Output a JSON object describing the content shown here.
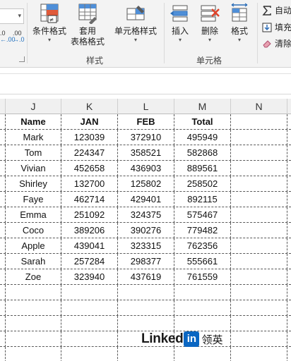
{
  "ribbon": {
    "decimal_buttons": [
      {
        "top": ".0",
        "bottom": "←.00"
      },
      {
        "top": ".00",
        "bottom": "→.0"
      }
    ],
    "style_group": {
      "label": "样式",
      "buttons": [
        {
          "label": "条件格式"
        },
        {
          "label": "套用",
          "label2": "表格格式"
        },
        {
          "label": "单元格样式"
        }
      ]
    },
    "cells_group": {
      "label": "单元格",
      "buttons": [
        {
          "label": "插入"
        },
        {
          "label": "删除"
        },
        {
          "label": "格式"
        }
      ]
    },
    "editing_group": {
      "items": [
        {
          "label": "自动"
        },
        {
          "label": "填充"
        },
        {
          "label": "清除"
        }
      ]
    },
    "accent_color": "#1f6fbf"
  },
  "sheet": {
    "column_headers": [
      "J",
      "K",
      "L",
      "M",
      "N"
    ],
    "header_row": [
      "Name",
      "JAN",
      "FEB",
      "Total"
    ],
    "rows": [
      [
        "Mark",
        "123039",
        "372910",
        "495949"
      ],
      [
        "Tom",
        "224347",
        "358521",
        "582868"
      ],
      [
        "Vivian",
        "452658",
        "436903",
        "889561"
      ],
      [
        "Shirley",
        "132700",
        "125802",
        "258502"
      ],
      [
        "Faye",
        "462714",
        "429401",
        "892115"
      ],
      [
        "Emma",
        "251092",
        "324375",
        "575467"
      ],
      [
        "Coco",
        "389206",
        "390276",
        "779482"
      ],
      [
        "Apple",
        "439041",
        "323315",
        "762356"
      ],
      [
        "Sarah",
        "257284",
        "298377",
        "555661"
      ],
      [
        "Zoe",
        "323940",
        "437619",
        "761559"
      ]
    ]
  },
  "watermark": {
    "word": "Linked",
    "in": "in",
    "cn": "领英"
  }
}
